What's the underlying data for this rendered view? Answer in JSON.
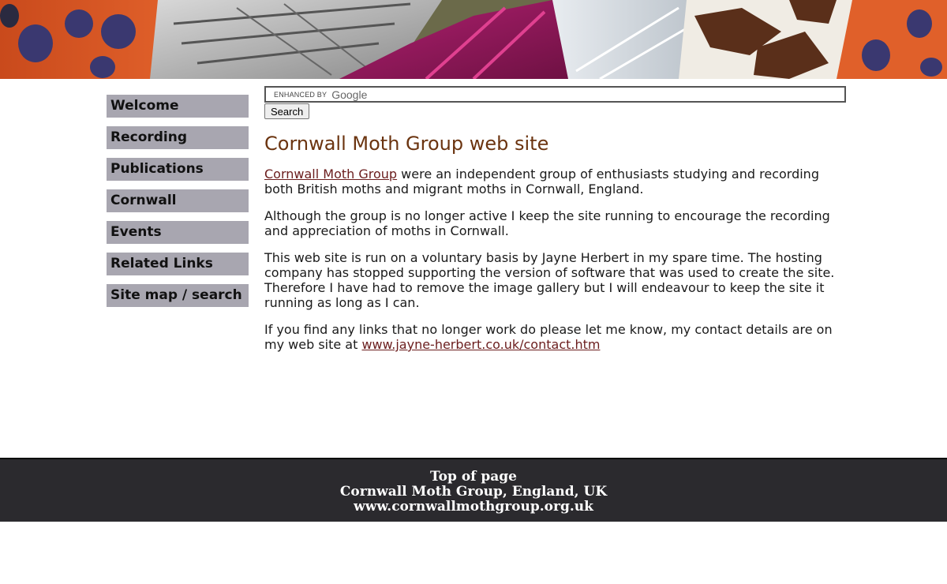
{
  "banner": {
    "alt": "moth wings banner"
  },
  "nav": {
    "items": [
      {
        "label": "Welcome"
      },
      {
        "label": "Recording"
      },
      {
        "label": "Publications"
      },
      {
        "label": "Cornwall"
      },
      {
        "label": "Events"
      },
      {
        "label": "Related Links"
      },
      {
        "label": "Site map / search"
      }
    ]
  },
  "search": {
    "enhanced_label": "ENHANCED BY",
    "brand": "Google",
    "value": "",
    "button_label": "Search"
  },
  "main": {
    "title": "Cornwall Moth Group web site",
    "p1_link": "Cornwall Moth Group",
    "p1_rest": " were an independent group of enthusiasts studying and recording both British moths and migrant moths in Cornwall, England.",
    "p2": "Although the group is no longer active I keep the site running to encourage the recording and appreciation of moths in Cornwall.",
    "p3": "This web site is run on a voluntary basis by Jayne Herbert in my spare time. The hosting company has stopped supporting the version of software that was used to create the site. Therefore I have had to remove the image gallery but I will endeavour to keep the site it running as long as I can.",
    "p4_text": "If you find any links that no longer work do please let me know, my contact details are on my web site at ",
    "p4_link": "www.jayne-herbert.co.uk/contact.htm"
  },
  "footer": {
    "top_link": "Top of page",
    "line2": "Cornwall Moth Group, England, UK",
    "line3": "www.cornwallmothgroup.org.uk"
  },
  "colors": {
    "nav_bg": "#a8a6b0",
    "title": "#6b3410",
    "link": "#6b1d1d",
    "footer_bg": "#2b2a2e"
  }
}
